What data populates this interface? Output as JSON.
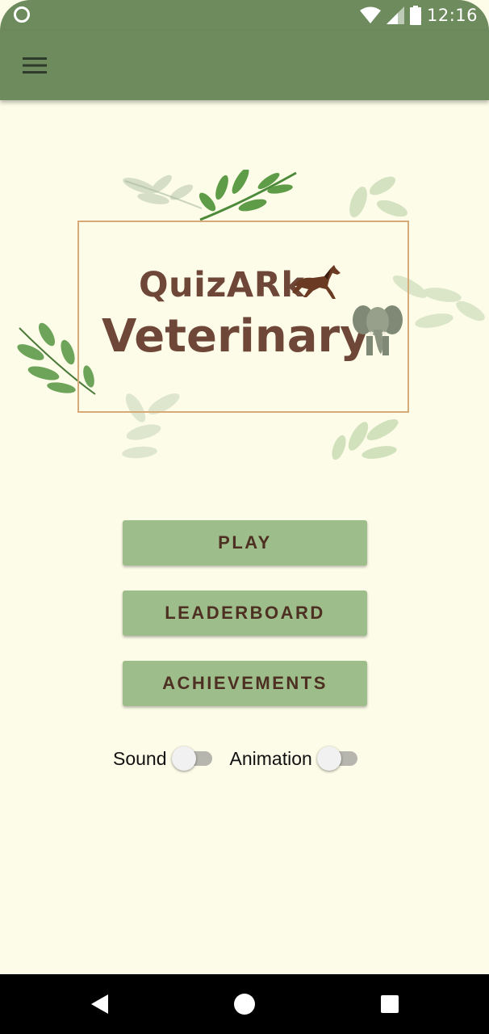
{
  "status_bar": {
    "time": "12:16",
    "icons": [
      "notification-circle-icon",
      "wifi-icon",
      "signal-icon",
      "battery-icon"
    ]
  },
  "app_bar": {
    "menu_icon": "hamburger-menu-icon",
    "background_color": "#6d8b5c"
  },
  "logo": {
    "line1": "QuizARk",
    "line2": "Veterinary",
    "text_color": "#6f4738",
    "frame_color": "#d7a878"
  },
  "menu": {
    "buttons": [
      {
        "label": "PLAY"
      },
      {
        "label": "LEADERBOARD"
      },
      {
        "label": "ACHIEVEMENTS"
      }
    ],
    "button_color": "#9dbd8b",
    "button_text_color": "#4e3022"
  },
  "settings": {
    "sound_label": "Sound",
    "sound_enabled": false,
    "animation_label": "Animation",
    "animation_enabled": false
  },
  "nav_bar": {
    "buttons": [
      "back-icon",
      "home-icon",
      "recents-icon"
    ]
  },
  "background_color": "#fdfce8"
}
